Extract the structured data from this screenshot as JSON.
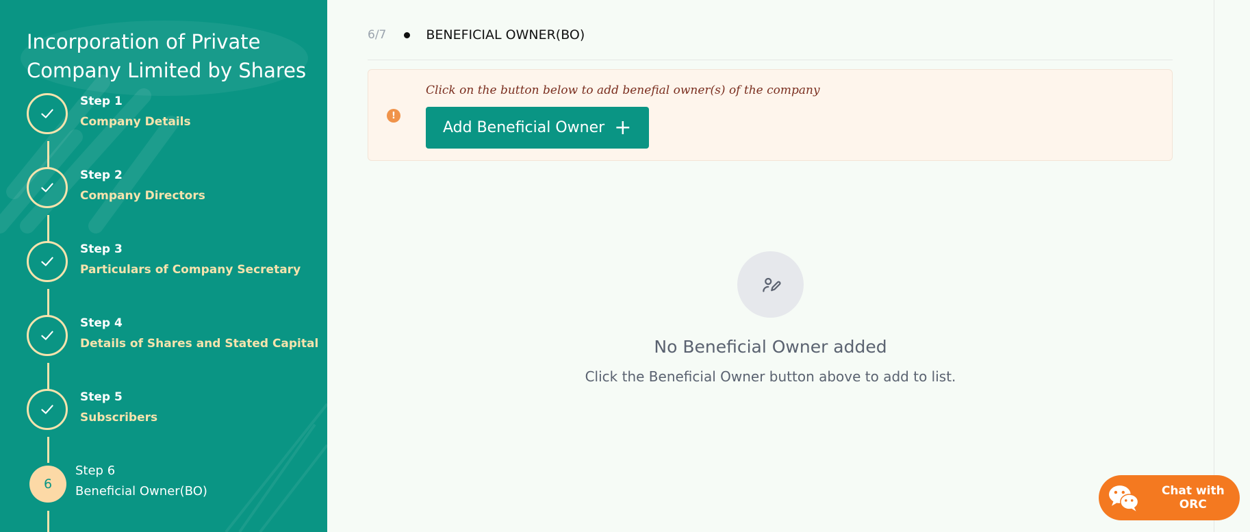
{
  "sidebar": {
    "title": "Incorporation of Private Company Limited by Shares",
    "steps": [
      {
        "num": "Step 1",
        "label": "Company Details",
        "state": "done"
      },
      {
        "num": "Step 2",
        "label": "Company Directors",
        "state": "done"
      },
      {
        "num": "Step 3",
        "label": "Particulars of Company Secretary",
        "state": "done"
      },
      {
        "num": "Step 4",
        "label": "Details of Shares and Stated Capital",
        "state": "done"
      },
      {
        "num": "Step 5",
        "label": "Subscribers",
        "state": "done"
      },
      {
        "num": "Step 6",
        "label": "Beneficial Owner(BO)",
        "state": "current",
        "badge": "6"
      }
    ]
  },
  "section": {
    "counter": "6/7",
    "title": "BENEFICIAL OWNER(BO)"
  },
  "notice": {
    "message": "Click on the button below to add benefial owner(s) of the company",
    "icon": "alert-circle-icon"
  },
  "add_button": {
    "label": "Add Beneficial Owner",
    "icon": "+"
  },
  "empty_state": {
    "icon": "edit-user-icon",
    "title": "No Beneficial Owner added",
    "subtitle": "Click the Beneficial Owner button above to add to list."
  },
  "chat": {
    "label": "Chat with ORC",
    "icon": "wechat-icon"
  },
  "colors": {
    "sidebar_bg": "#0a9584",
    "accent_cream": "#f6e3ad",
    "button_teal": "#0a9584",
    "chat_orange": "#f47920",
    "notice_bg": "#fef5ec"
  }
}
